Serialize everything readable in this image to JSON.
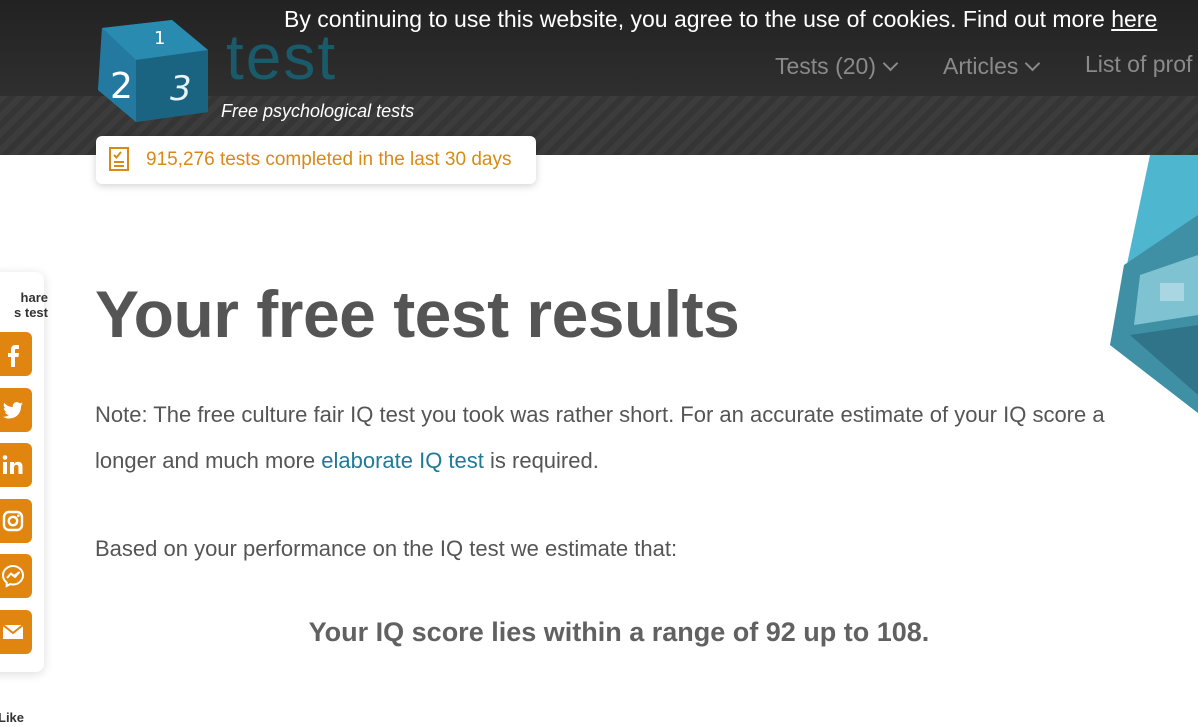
{
  "cookie_notice": {
    "text": "By continuing to use this website, you agree to the use of cookies. Find out more ",
    "link": "here"
  },
  "logo": {
    "word": "test",
    "cube_digits": [
      "1",
      "2",
      "3"
    ],
    "tagline": "Free psychological tests"
  },
  "nav": {
    "items": [
      {
        "label": "Tests (20)",
        "has_dropdown": true
      },
      {
        "label": "Articles",
        "has_dropdown": true
      },
      {
        "label": "List of prof",
        "has_dropdown": false
      }
    ]
  },
  "counter": {
    "icon": "checklist-icon",
    "text": "915,276 tests completed in the last 30 days"
  },
  "share": {
    "title_line1": "hare",
    "title_line2": "s test",
    "buttons": [
      {
        "name": "facebook",
        "icon": "facebook-icon"
      },
      {
        "name": "twitter",
        "icon": "twitter-icon"
      },
      {
        "name": "linkedin",
        "icon": "linkedin-icon"
      },
      {
        "name": "instagram",
        "icon": "instagram-icon"
      },
      {
        "name": "messenger",
        "icon": "messenger-icon"
      },
      {
        "name": "email",
        "icon": "email-icon"
      }
    ],
    "like_label": "Like"
  },
  "main": {
    "title": "Your free test results",
    "note_before": "Note: The free culture fair IQ test you took was rather short. For an accurate estimate of your IQ score a longer and much more ",
    "note_link": "elaborate IQ test",
    "note_after": " is required.",
    "based_on": "Based on your performance on the IQ test we estimate that:",
    "result": "Your IQ score lies within a range of 92 up to 108."
  },
  "colors": {
    "accent_orange": "#e08510",
    "link_blue": "#1f7a99",
    "logo_teal": "#1a5b6b",
    "header_bg": "#2b2b2b"
  }
}
